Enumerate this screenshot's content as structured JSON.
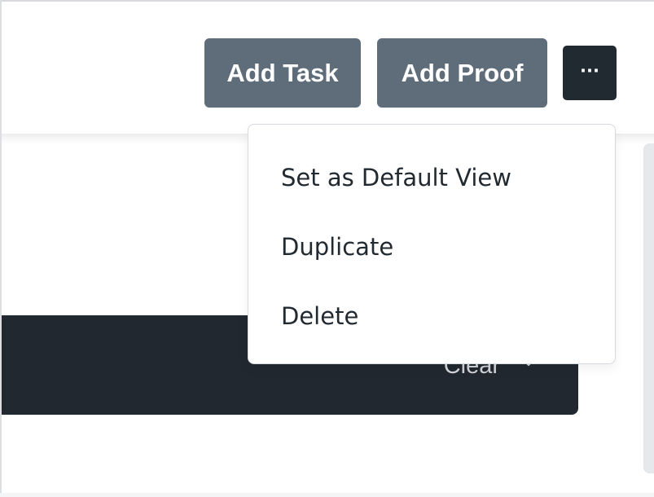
{
  "toolbar": {
    "add_task_label": "Add Task",
    "add_proof_label": "Add Proof",
    "more_label": "···"
  },
  "filter_bar": {
    "clear_label": "Clear"
  },
  "dropdown_menu": {
    "items": [
      {
        "label": "Set as Default View"
      },
      {
        "label": "Duplicate"
      },
      {
        "label": "Delete"
      }
    ]
  },
  "colors": {
    "secondary_button": "#5f6d7b",
    "dark_button": "#212931",
    "dark_bar": "#212830",
    "menu_text": "#222a31"
  },
  "icons": {
    "more": "more-horizontal-icon",
    "clear_chevron": "chevron-down-icon"
  }
}
